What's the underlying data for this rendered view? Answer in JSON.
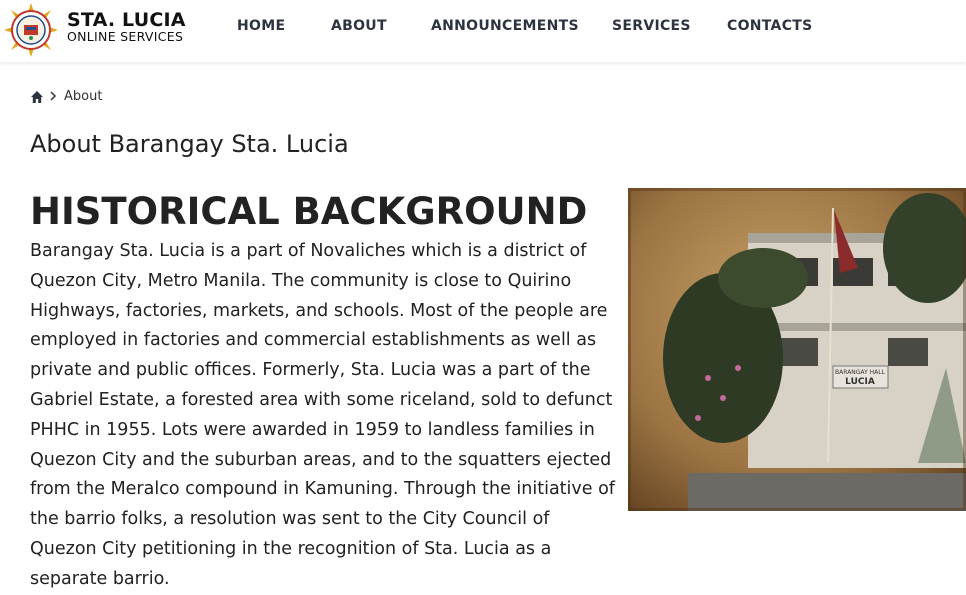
{
  "brand": {
    "title": "STA. LUCIA",
    "subtitle": "ONLINE SERVICES"
  },
  "nav": {
    "items": [
      {
        "label": "HOME"
      },
      {
        "label": "ABOUT"
      },
      {
        "label": "ANNOUNCEMENTS"
      },
      {
        "label": "SERVICES"
      },
      {
        "label": "CONTACTS"
      }
    ]
  },
  "breadcrumb": {
    "current": "About"
  },
  "page": {
    "title": "About Barangay Sta. Lucia",
    "section_title": "HISTORICAL BACKGROUND",
    "body": "Barangay Sta. Lucia is a part of Novaliches which is a district of Quezon City, Metro Manila. The community is close to Quirino Highways, factories, markets, and schools. Most of the people are employed in factories and commercial establishments as well as private and public offices. Formerly, Sta. Lucia was a part of the Gabriel Estate, a forested area with some riceland, sold to defunct PHHC in 1955. Lots were awarded in 1959 to landless families in Quezon City and the suburban areas, and to the squatters ejected from the Meralco compound in Kamuning. Through the initiative of the barrio folks, a resolution was sent to the City Council of Quezon City petitioning in the recognition of Sta. Lucia as a separate barrio."
  },
  "photo": {
    "sign_line1": "BARANGAY HALL",
    "sign_line2": "LUCIA"
  },
  "colors": {
    "nav_text": "#2d3440",
    "text": "#222222",
    "sepia": "#8a6a3c"
  },
  "icons": {
    "home": "home-icon",
    "separator": "chevron-right-icon"
  }
}
